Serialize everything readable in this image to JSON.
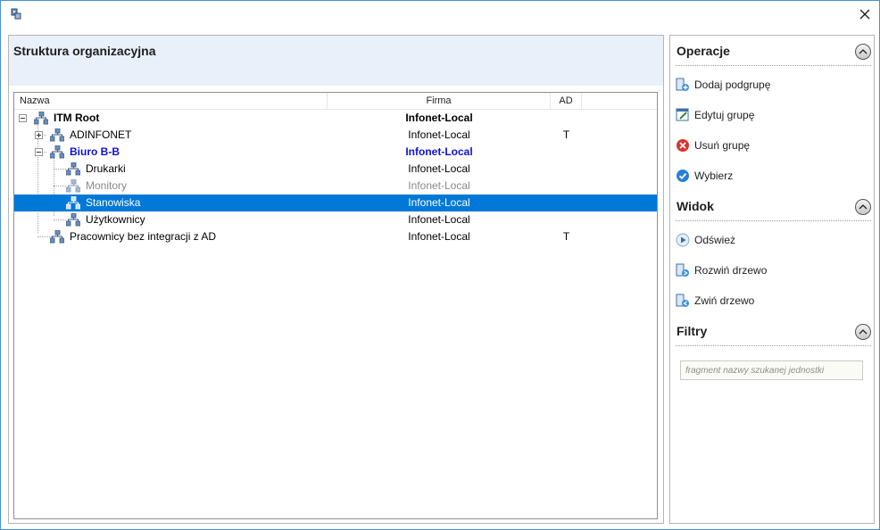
{
  "window": {
    "close_glyph": "×"
  },
  "left": {
    "title": "Struktura organizacyjna",
    "columns": {
      "name": "Nazwa",
      "firma": "Firma",
      "ad": "AD"
    },
    "rows": [
      {
        "name": "ITM Root",
        "firma": "Infonet-Local",
        "ad": ""
      },
      {
        "name": "ADINFONET",
        "firma": "Infonet-Local",
        "ad": "T"
      },
      {
        "name": "Biuro B-B",
        "firma": "Infonet-Local",
        "ad": ""
      },
      {
        "name": "Drukarki",
        "firma": "Infonet-Local",
        "ad": ""
      },
      {
        "name": "Monitory",
        "firma": "Infonet-Local",
        "ad": ""
      },
      {
        "name": "Stanowiska",
        "firma": "Infonet-Local",
        "ad": ""
      },
      {
        "name": "Użytkownicy",
        "firma": "Infonet-Local",
        "ad": ""
      },
      {
        "name": "Pracownicy bez integracji z AD",
        "firma": "Infonet-Local",
        "ad": "T"
      }
    ]
  },
  "right": {
    "operacje": {
      "title": "Operacje",
      "items": [
        "Dodaj podgrupę",
        "Edytuj grupę",
        "Usuń grupę",
        "Wybierz"
      ]
    },
    "widok": {
      "title": "Widok",
      "items": [
        "Odśwież",
        "Rozwiń drzewo",
        "Zwiń drzewo"
      ]
    },
    "filtry": {
      "title": "Filtry",
      "placeholder": "fragment nazwy szukanej jednostki"
    }
  },
  "colors": {
    "selection": "#0078d7",
    "highlight_text": "#1010d8",
    "header_bg": "#e9f0fa"
  }
}
